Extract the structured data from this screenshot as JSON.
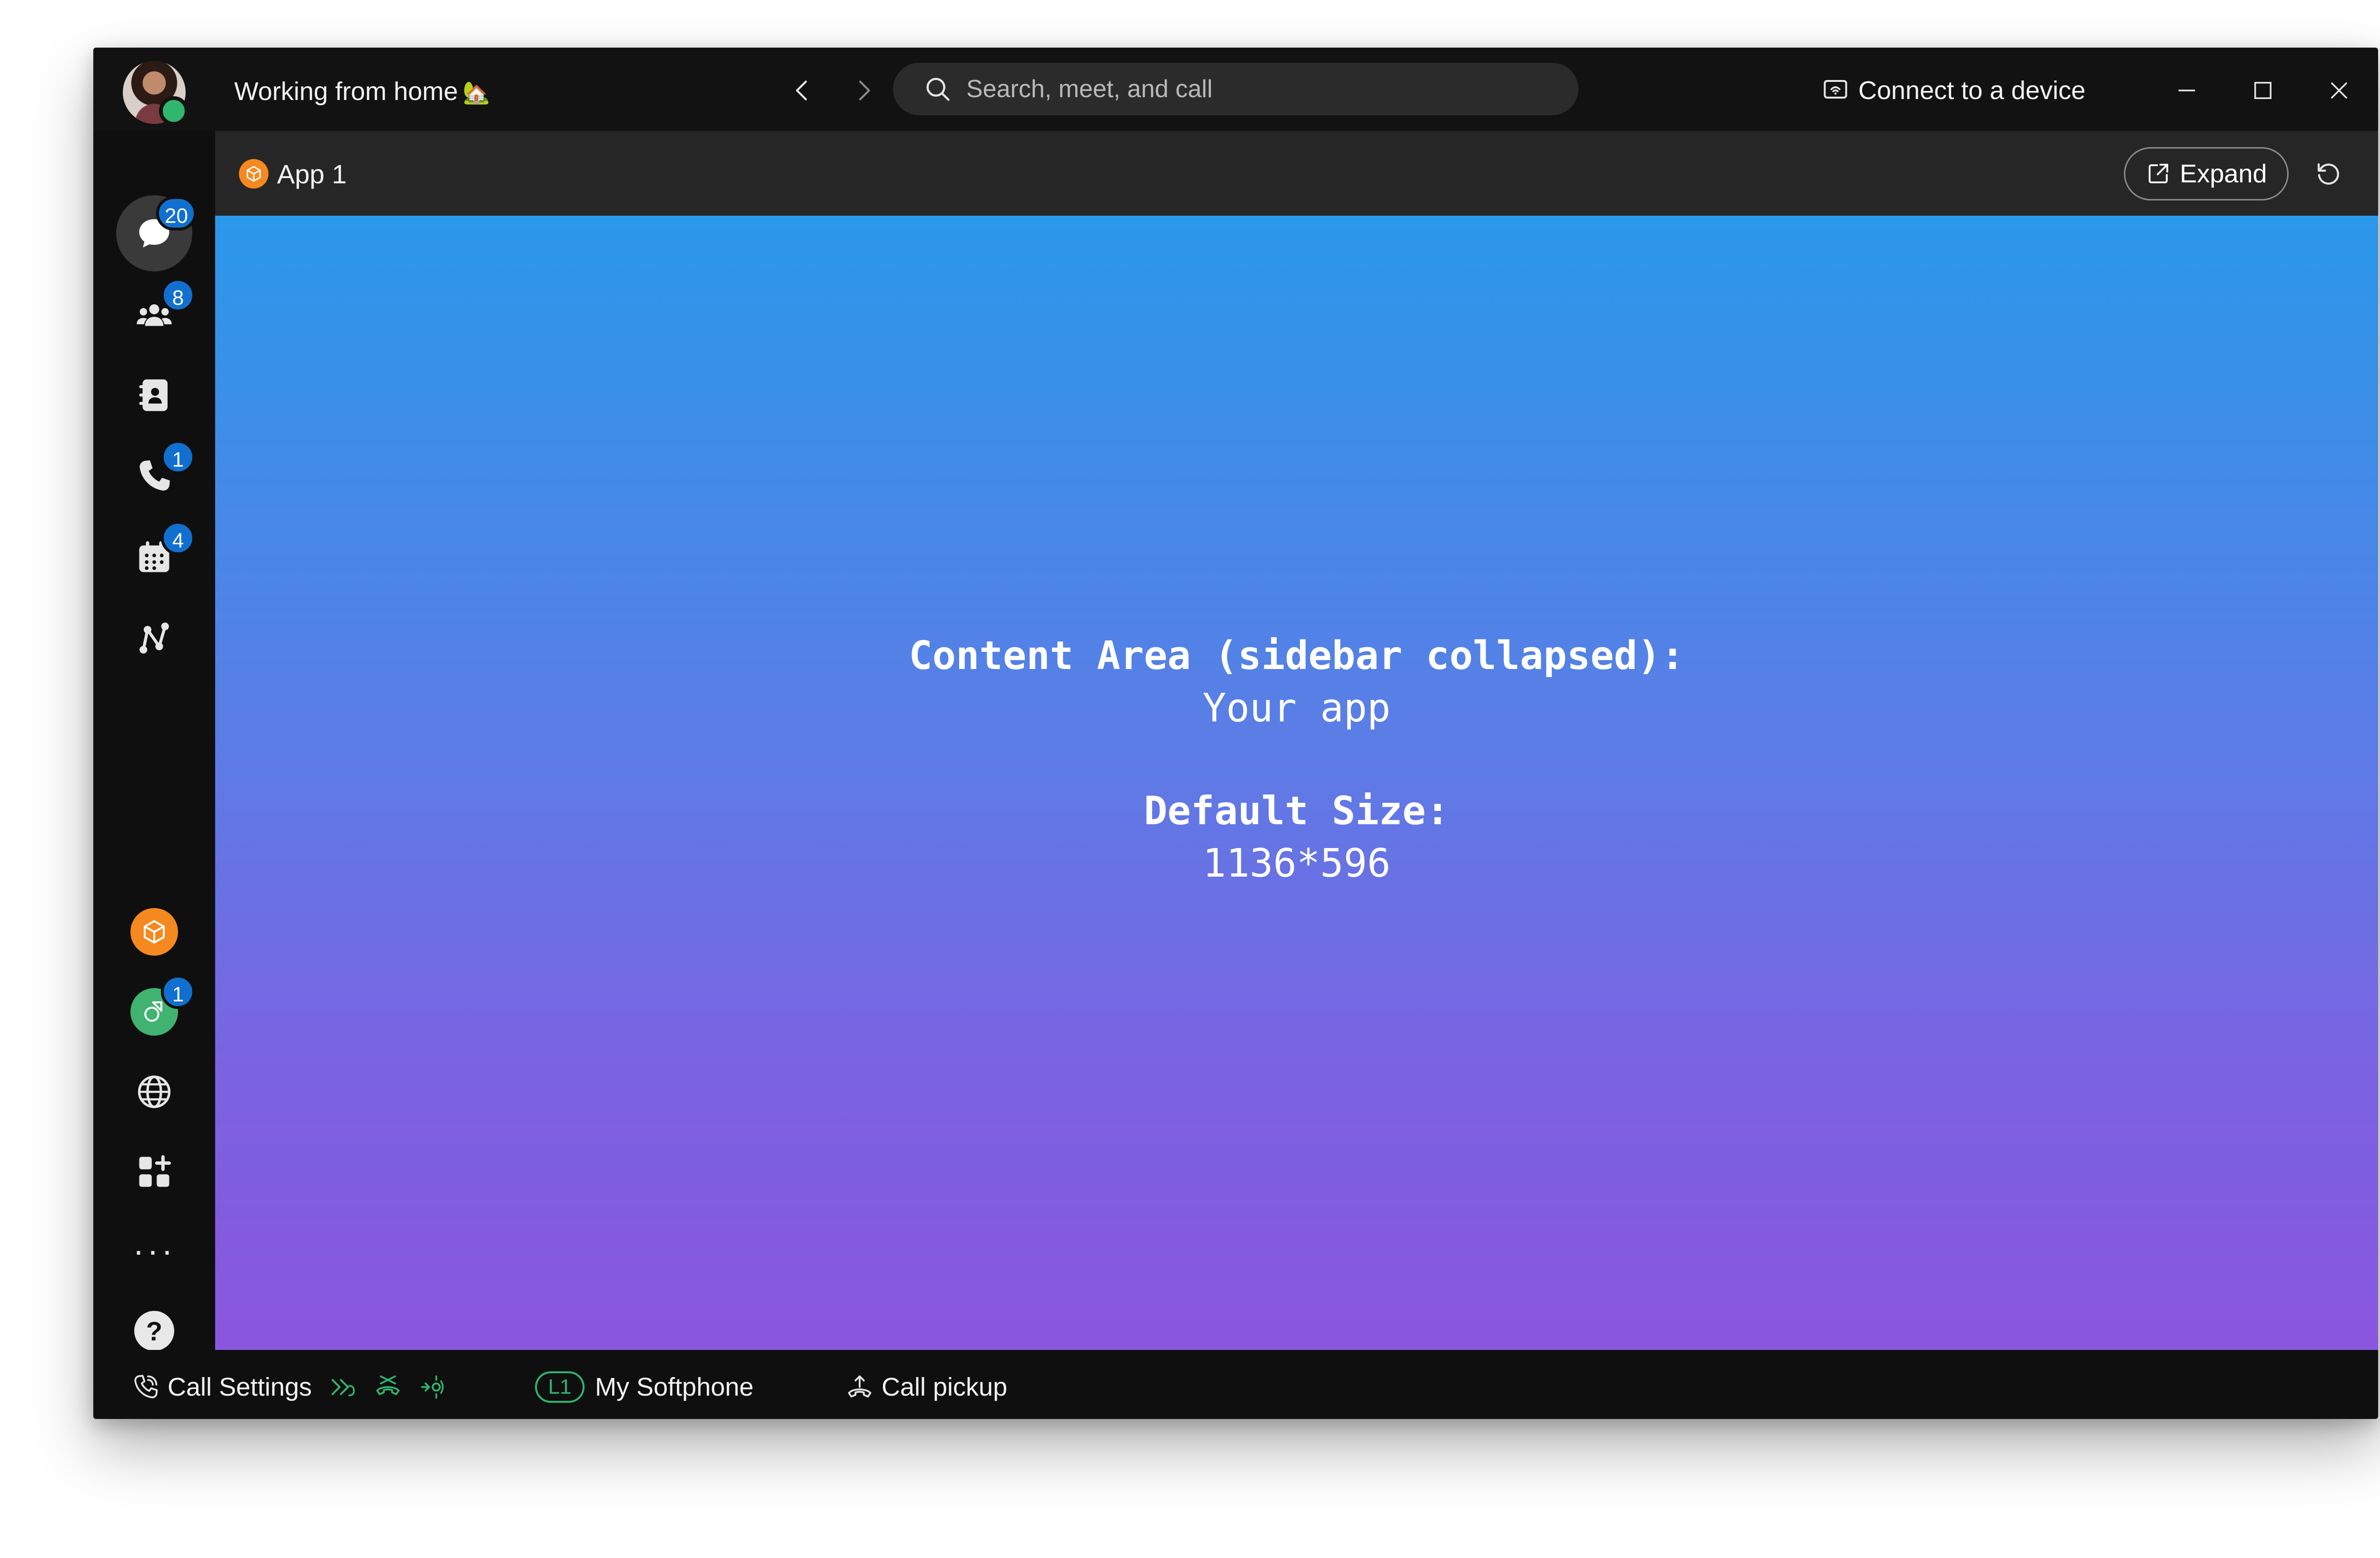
{
  "titlebar": {
    "status_text": "Working from home",
    "status_emoji": "🏡",
    "search_placeholder": "Search, meet, and call",
    "connect_label": "Connect to a device"
  },
  "sidebar": {
    "badges": {
      "messaging": "20",
      "teams": "8",
      "calling": "1",
      "meetings": "4",
      "embedded_app": "1"
    },
    "help_glyph": "?",
    "more_glyph": "···"
  },
  "tabbar": {
    "app_tab_label": "App 1",
    "expand_label": "Expand"
  },
  "content": {
    "title": "Content Area (sidebar collapsed):",
    "subtitle": "Your app",
    "size_title": "Default Size:",
    "size_value": "1136*596"
  },
  "bottombar": {
    "call_settings_label": "Call Settings",
    "line_badge": "L1",
    "softphone_label": "My Softphone",
    "call_pickup_label": "Call pickup"
  },
  "colors": {
    "accent_blue": "#1170cf",
    "presence_green": "#2fb66f",
    "app_orange": "#f5891f",
    "gradient_top": "#2a98ea",
    "gradient_bottom": "#8a56df"
  }
}
